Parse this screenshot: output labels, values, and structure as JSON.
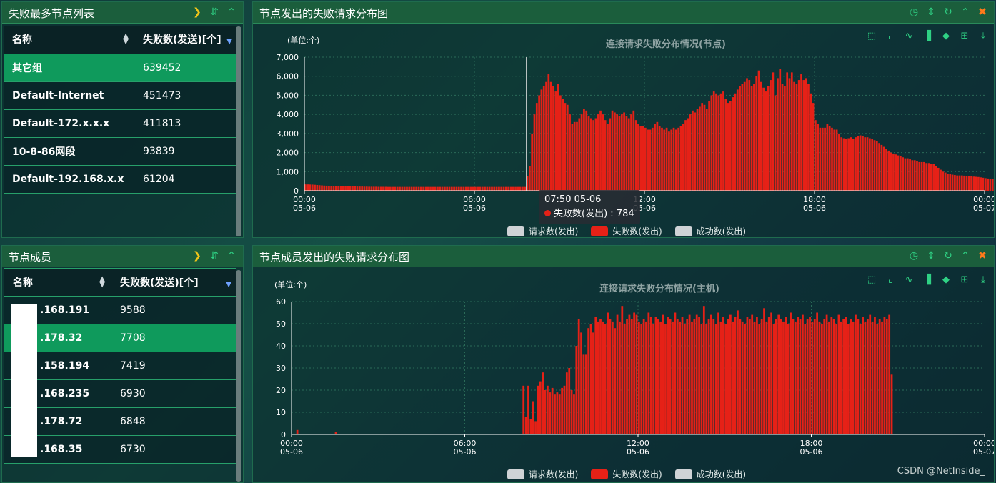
{
  "left_top": {
    "title": "失败最多节点列表",
    "col_name": "名称",
    "col_value": "失败数(发送)[个]",
    "rows": [
      {
        "name": "其它组",
        "value": "639452"
      },
      {
        "name": "Default-Internet",
        "value": "451473"
      },
      {
        "name": "Default-172.x.x.x",
        "value": "411813"
      },
      {
        "name": "10-8-86网段",
        "value": "93839"
      },
      {
        "name": "Default-192.168.x.x",
        "value": "61204"
      }
    ]
  },
  "left_bottom": {
    "title": "节点成员",
    "col_name": "名称",
    "col_value": "失败数(发送)[个]",
    "rows": [
      {
        "name": ".168.191",
        "value": "9588"
      },
      {
        "name": ".178.32",
        "value": "7708"
      },
      {
        "name": ".158.194",
        "value": "7419"
      },
      {
        "name": ".168.235",
        "value": "6930"
      },
      {
        "name": ".178.72",
        "value": "6848"
      },
      {
        "name": ".168.35",
        "value": "6730"
      }
    ]
  },
  "icons": {
    "expand": "chevron-right-icon",
    "sort": "sort-icon",
    "collapse": "chevron-up-icon",
    "clock": "clock-icon",
    "resize": "vertical-arrows-icon",
    "refresh": "refresh-icon",
    "close": "close-icon"
  },
  "colors": {
    "fail": "#e62117",
    "request": "#cfd3d6",
    "success": "#cfd3d6",
    "header": "#1b5e3c",
    "accent": "#2fd184"
  },
  "chart_top_panel": {
    "title": "节点发出的失败请求分布图"
  },
  "chart_bottom_panel": {
    "title": "节点成员发出的失败请求分布图"
  },
  "legend": {
    "request": "请求数(发出)",
    "fail": "失败数(发出)",
    "success": "成功数(发出)"
  },
  "tooltip": {
    "time": "07:50 05-06",
    "series": "失败数(发出)",
    "value": "784"
  },
  "watermark": "CSDN @NetInside_",
  "chart_data": [
    {
      "type": "bar",
      "title": "连接请求失败分布情况(节点)",
      "ylabel": "(单位:个)",
      "ylim": [
        0,
        7000
      ],
      "yticks": [
        "0",
        "1,000",
        "2,000",
        "3,000",
        "4,000",
        "5,000",
        "6,000",
        "7,000"
      ],
      "xticks": [
        {
          "time": "00:00",
          "date": "05-06"
        },
        {
          "time": "06:00",
          "date": "05-06"
        },
        {
          "time": "12:00",
          "date": "05-06"
        },
        {
          "time": "18:00",
          "date": "05-06"
        },
        {
          "time": "00:00",
          "date": "05-07"
        }
      ],
      "x_start": "2023-05-06 00:00",
      "x_end": "2023-05-07 00:00",
      "interval_minutes": 5,
      "series": [
        {
          "name": "失败数(发出)",
          "values": [
            330,
            330,
            325,
            320,
            310,
            300,
            290,
            280,
            270,
            265,
            260,
            255,
            250,
            245,
            240,
            240,
            235,
            235,
            230,
            230,
            225,
            225,
            220,
            220,
            220,
            215,
            215,
            210,
            210,
            210,
            210,
            205,
            205,
            205,
            205,
            200,
            200,
            200,
            200,
            200,
            200,
            200,
            200,
            200,
            200,
            200,
            200,
            200,
            200,
            200,
            200,
            200,
            200,
            200,
            200,
            200,
            200,
            200,
            200,
            200,
            200,
            200,
            200,
            200,
            200,
            200,
            200,
            200,
            200,
            200,
            200,
            200,
            200,
            200,
            200,
            200,
            200,
            200,
            200,
            200,
            200,
            200,
            200,
            200,
            200,
            200,
            200,
            200,
            200,
            200,
            200,
            200,
            200,
            200,
            784,
            1300,
            3000,
            4000,
            4600,
            5000,
            5300,
            5500,
            5700,
            6100,
            5700,
            5500,
            5200,
            5600,
            5000,
            4800,
            4600,
            4500,
            4000,
            3500,
            3600,
            3600,
            3800,
            4000,
            4300,
            4200,
            3900,
            3800,
            3700,
            3800,
            4000,
            4200,
            4000,
            3700,
            3500,
            3800,
            4200,
            4100,
            4000,
            3900,
            4000,
            4100,
            3900,
            3800,
            4000,
            4200,
            3700,
            3500,
            3400,
            3400,
            3300,
            3200,
            3200,
            3300,
            3500,
            3600,
            3400,
            3300,
            3200,
            3300,
            3100,
            3200,
            3300,
            3200,
            3300,
            3400,
            3500,
            3700,
            3800,
            4000,
            4200,
            4100,
            4300,
            4400,
            4600,
            4500,
            4300,
            4700,
            5000,
            5200,
            5100,
            5000,
            5100,
            5200,
            4800,
            4600,
            4700,
            4900,
            5100,
            5300,
            5500,
            5600,
            5700,
            5900,
            5800,
            5500,
            5600,
            6000,
            6300,
            5700,
            5400,
            5200,
            5500,
            5800,
            6200,
            5000,
            5900,
            6400,
            5600,
            5500,
            6200,
            5900,
            6200,
            5700,
            5600,
            5800,
            6100,
            5800,
            5900,
            5600,
            5100,
            4600,
            3700,
            3500,
            3300,
            3300,
            3300,
            3500,
            3400,
            3300,
            3200,
            3200,
            3000,
            2800,
            2750,
            2700,
            2750,
            2800,
            2700,
            2800,
            2850,
            2900,
            2850,
            2800,
            2800,
            2750,
            2700,
            2650,
            2600,
            2500,
            2400,
            2300,
            2200,
            2100,
            2000,
            1950,
            1900,
            1850,
            1800,
            1750,
            1700,
            1700,
            1650,
            1600,
            1600,
            1550,
            1500,
            1500,
            1500,
            1450,
            1450,
            1400,
            1400,
            1300,
            1200,
            1100,
            1000,
            950,
            900,
            860,
            840,
            820,
            800,
            800,
            800,
            790,
            780,
            760,
            750,
            740,
            730,
            720,
            700,
            680,
            660,
            640,
            620,
            600,
            580,
            560,
            540,
            520,
            500,
            480,
            470,
            460,
            450,
            450,
            450
          ]
        }
      ]
    },
    {
      "type": "bar",
      "title": "连接请求失败分布情况(主机)",
      "ylabel": "(单位:个)",
      "ylim": [
        0,
        60
      ],
      "yticks": [
        "0",
        "10",
        "20",
        "30",
        "40",
        "50",
        "60"
      ],
      "xticks": [
        {
          "time": "00:00",
          "date": "05-06"
        },
        {
          "time": "06:00",
          "date": "05-06"
        },
        {
          "time": "12:00",
          "date": "05-06"
        },
        {
          "time": "18:00",
          "date": "05-06"
        },
        {
          "time": "00:00",
          "date": "05-07"
        }
      ],
      "x_start": "2023-05-06 00:00",
      "x_end": "2023-05-07 00:00",
      "interval_minutes": 5,
      "series": [
        {
          "name": "失败数(发出)",
          "values": [
            0,
            0,
            2,
            0,
            0,
            0,
            0,
            0,
            0,
            0,
            0,
            0,
            0,
            0,
            0,
            0,
            0,
            0,
            1,
            0,
            0,
            0,
            0,
            0,
            0,
            0,
            0,
            0,
            0,
            0,
            0,
            0,
            0,
            0,
            0,
            0,
            0,
            0,
            0,
            0,
            0,
            0,
            0,
            0,
            0,
            0,
            0,
            0,
            0,
            0,
            0,
            0,
            0,
            0,
            0,
            0,
            0,
            0,
            0,
            0,
            0,
            0,
            0,
            0,
            0,
            0,
            0,
            0,
            0,
            0,
            0,
            0,
            0,
            0,
            0,
            0,
            0,
            0,
            0,
            0,
            0,
            0,
            0,
            0,
            0,
            0,
            0,
            0,
            0,
            0,
            0,
            0,
            0,
            0,
            0,
            0,
            22,
            8,
            22,
            7,
            15,
            6,
            22,
            24,
            28,
            20,
            22,
            19,
            21,
            18,
            19,
            18,
            21,
            22,
            28,
            30,
            20,
            18,
            40,
            52,
            46,
            36,
            36,
            48,
            50,
            46,
            53,
            51,
            52,
            51,
            50,
            55,
            52,
            51,
            48,
            54,
            51,
            58,
            50,
            52,
            54,
            52,
            55,
            54,
            51,
            50,
            52,
            51,
            55,
            53,
            50,
            53,
            52,
            51,
            54,
            50,
            53,
            52,
            51,
            55,
            52,
            51,
            53,
            50,
            52,
            54,
            51,
            52,
            54,
            53,
            50,
            58,
            50,
            52,
            54,
            52,
            50,
            55,
            51,
            53,
            50,
            52,
            54,
            51,
            53,
            56,
            52,
            51,
            50,
            53,
            52,
            54,
            51,
            53,
            50,
            52,
            57,
            51,
            53,
            55,
            50,
            52,
            54,
            52,
            51,
            53,
            50,
            55,
            52,
            51,
            53,
            52,
            54,
            50,
            52,
            53,
            51,
            52,
            55,
            51,
            50,
            52,
            54,
            51,
            53,
            52,
            50,
            54,
            51,
            52,
            53,
            50,
            52,
            51,
            54,
            52,
            50,
            53,
            51,
            52,
            54,
            51,
            53,
            50,
            52,
            51,
            53,
            52,
            54,
            27
          ]
        }
      ]
    }
  ]
}
